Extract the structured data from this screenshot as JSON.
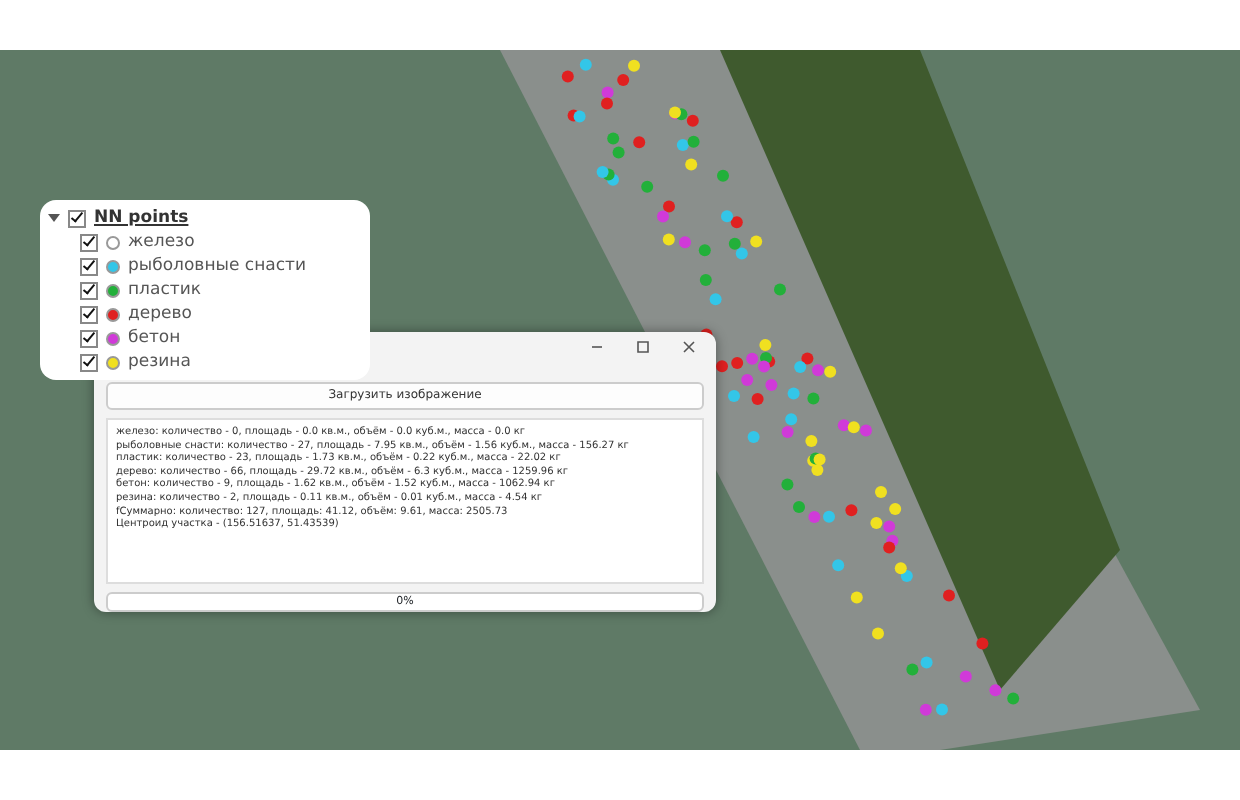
{
  "legend": {
    "layer": {
      "label": "NN points",
      "checked": true,
      "expanded": true
    },
    "items": [
      {
        "label": "железо",
        "checked": true,
        "color": "#ffffff"
      },
      {
        "label": "рыболовные снасти",
        "checked": true,
        "color": "#33c6e8"
      },
      {
        "label": "пластик",
        "checked": true,
        "color": "#22b03a"
      },
      {
        "label": "дерево",
        "checked": true,
        "color": "#e02020"
      },
      {
        "label": "бетон",
        "checked": true,
        "color": "#d03ad8"
      },
      {
        "label": "резина",
        "checked": true,
        "color": "#f0e020"
      }
    ]
  },
  "window": {
    "load_button": "Загрузить изображение",
    "report_lines": [
      "железо: количество - 0,  площадь - 0.0 кв.м., объём - 0.0 куб.м., масса - 0.0 кг",
      "рыболовные снасти: количество - 27,  площадь - 7.95 кв.м., объём - 1.56 куб.м., масса - 156.27 кг",
      "пластик: количество - 23,  площадь - 1.73 кв.м., объём - 0.22 куб.м., масса - 22.02 кг",
      "дерево: количество - 66,  площадь - 29.72 кв.м., объём - 6.3 куб.м., масса - 1259.96 кг",
      "бетон: количество - 9,  площадь - 1.62 кв.м., объём - 1.52 куб.м., масса - 1062.94 кг",
      "резина: количество - 2,  площадь - 0.11 кв.м., объём - 0.01 куб.м., масса - 4.54 кг",
      "fСуммарно: количество: 127, площадь: 41.12, объём: 9.61, масса: 2505.73",
      "Центроид участка - (156.51637, 51.43539)"
    ],
    "progress": {
      "level": 0,
      "reading": "0%"
    }
  }
}
